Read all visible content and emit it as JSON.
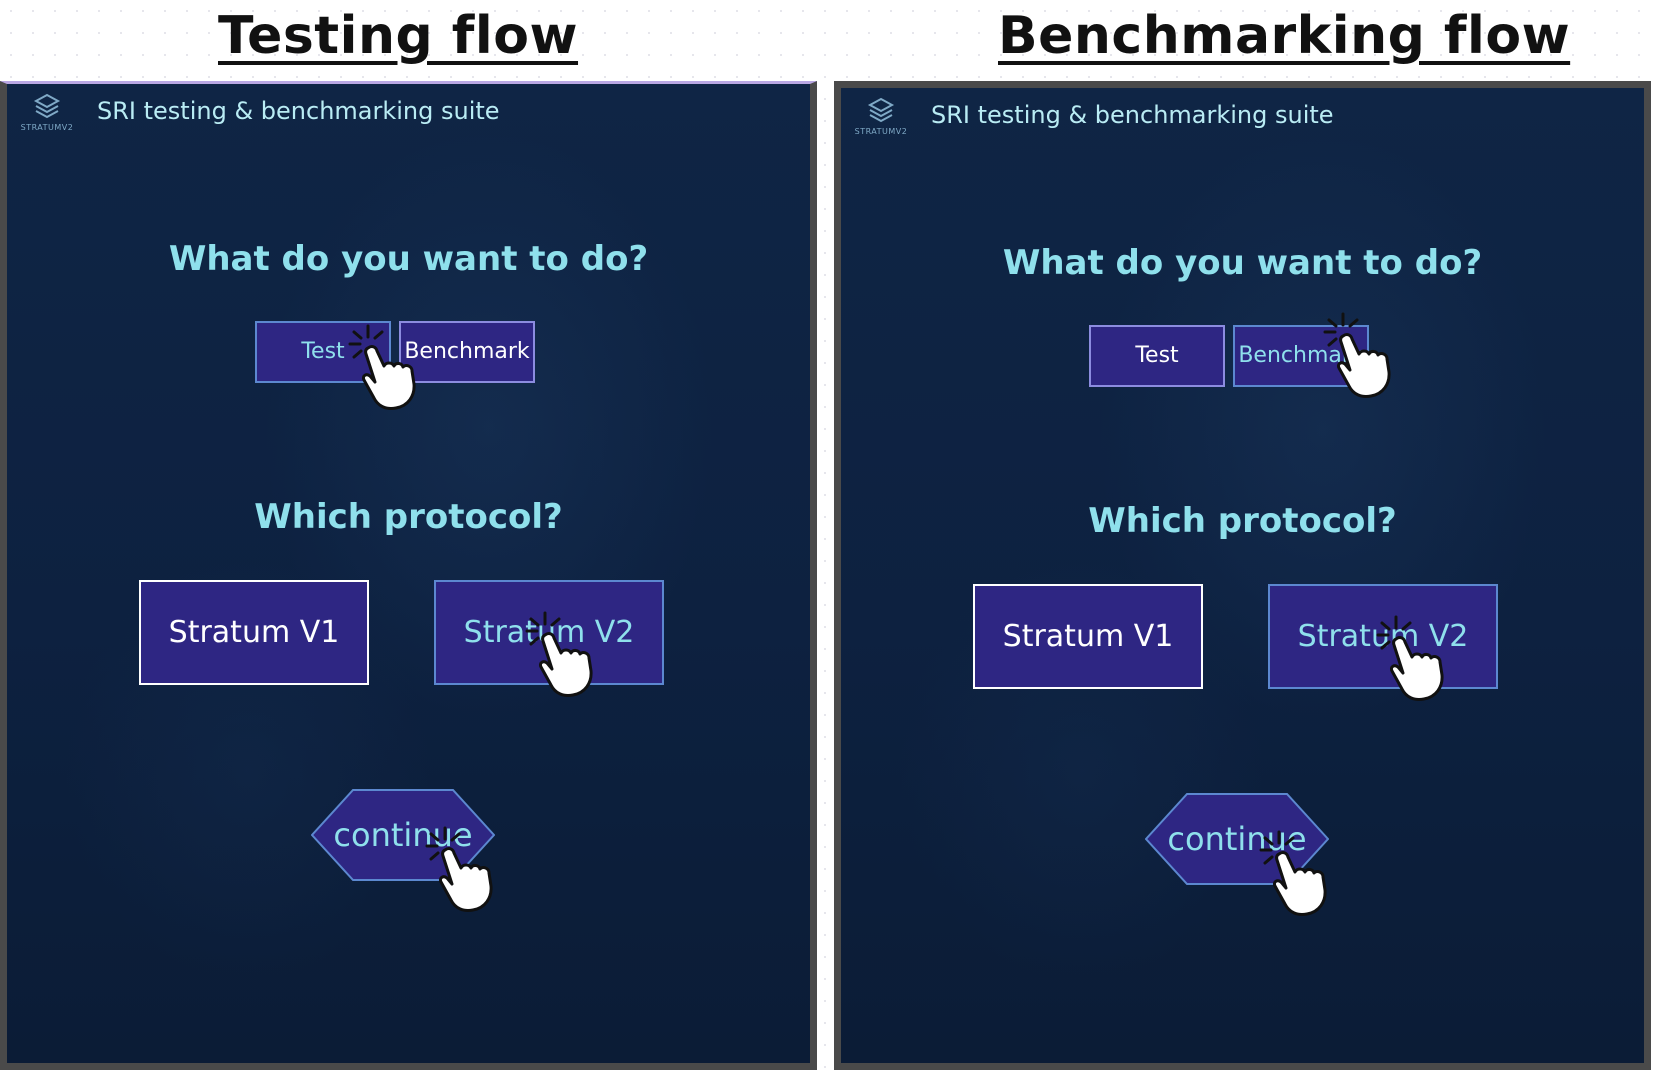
{
  "flows": {
    "testing": {
      "heading": "Testing flow",
      "app_title": "SRI testing & benchmarking suite",
      "logo_text": "STRATUMV2",
      "question_action": "What do you want to do?",
      "actions": {
        "test": "Test",
        "benchmark": "Benchmark"
      },
      "selected_action": "Test",
      "question_protocol": "Which protocol?",
      "protocols": {
        "v1": "Stratum V1",
        "v2": "Stratum V2"
      },
      "selected_protocol": "Stratum V2",
      "continue_label": "continue"
    },
    "benchmarking": {
      "heading": "Benchmarking flow",
      "app_title": "SRI testing & benchmarking suite",
      "logo_text": "STRATUMV2",
      "question_action": "What do you want to do?",
      "actions": {
        "test": "Test",
        "benchmark": "Benchmark"
      },
      "selected_action": "Benchmark",
      "question_protocol": "Which protocol?",
      "protocols": {
        "v1": "Stratum V1",
        "v2": "Stratum V2"
      },
      "selected_protocol": "Stratum V2",
      "continue_label": "continue"
    }
  },
  "colors": {
    "panel_bg": "#0d2140",
    "button_bg": "#2e2683",
    "accent_text": "#8fe0ec",
    "frame": "#4a4a4a"
  },
  "icons": [
    "stratum-logo-icon",
    "click-hand-icon"
  ]
}
